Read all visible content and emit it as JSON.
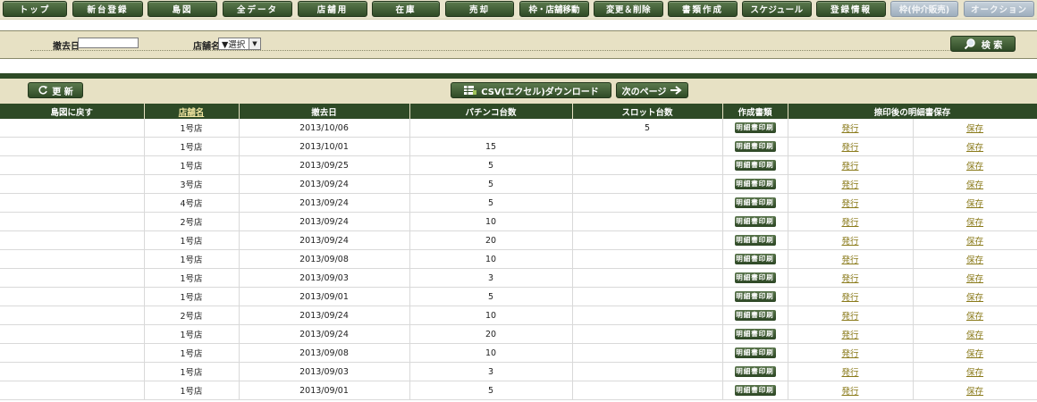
{
  "nav": [
    {
      "label": "トップ",
      "disabled": false
    },
    {
      "label": "新台登録",
      "disabled": false
    },
    {
      "label": "島図",
      "disabled": false
    },
    {
      "label": "全データ",
      "disabled": false
    },
    {
      "label": "店舗用",
      "disabled": false
    },
    {
      "label": "在庫",
      "disabled": false
    },
    {
      "label": "売却",
      "disabled": false
    },
    {
      "label": "枠・店舗移動",
      "disabled": false
    },
    {
      "label": "変更＆削除",
      "disabled": false
    },
    {
      "label": "書類作成",
      "disabled": false
    },
    {
      "label": "スケジュール",
      "disabled": false
    },
    {
      "label": "登録情報",
      "disabled": false
    },
    {
      "label": "枠(仲介販売)",
      "disabled": true
    },
    {
      "label": "オークション",
      "disabled": true
    }
  ],
  "search": {
    "date_label": "撤去日",
    "date_value": "",
    "store_label": "店舗名",
    "store_selected": "▼選択",
    "search_label": "検 索"
  },
  "toolbar": {
    "refresh_label": "更 新",
    "csv_label": "CSV(エクセル)ダウンロード",
    "next_label": "次のページ"
  },
  "table": {
    "headers": [
      "島図に戻す",
      "店舗名",
      "撤去日",
      "パチンコ台数",
      "スロット台数",
      "作成書類",
      "捺印後の明細書保存"
    ],
    "print_label": "明細書印刷",
    "issue_label": "発行",
    "save_label": "保存",
    "rows": [
      {
        "store": "1号店",
        "date": "2013/10/06",
        "pachinko": "",
        "slot": "5"
      },
      {
        "store": "1号店",
        "date": "2013/10/01",
        "pachinko": "15",
        "slot": ""
      },
      {
        "store": "1号店",
        "date": "2013/09/25",
        "pachinko": "5",
        "slot": ""
      },
      {
        "store": "3号店",
        "date": "2013/09/24",
        "pachinko": "5",
        "slot": ""
      },
      {
        "store": "4号店",
        "date": "2013/09/24",
        "pachinko": "5",
        "slot": ""
      },
      {
        "store": "2号店",
        "date": "2013/09/24",
        "pachinko": "10",
        "slot": ""
      },
      {
        "store": "1号店",
        "date": "2013/09/24",
        "pachinko": "20",
        "slot": ""
      },
      {
        "store": "1号店",
        "date": "2013/09/08",
        "pachinko": "10",
        "slot": ""
      },
      {
        "store": "1号店",
        "date": "2013/09/03",
        "pachinko": "3",
        "slot": ""
      },
      {
        "store": "1号店",
        "date": "2013/09/01",
        "pachinko": "5",
        "slot": ""
      },
      {
        "store": "2号店",
        "date": "2013/09/24",
        "pachinko": "10",
        "slot": ""
      },
      {
        "store": "1号店",
        "date": "2013/09/24",
        "pachinko": "20",
        "slot": ""
      },
      {
        "store": "1号店",
        "date": "2013/09/08",
        "pachinko": "10",
        "slot": ""
      },
      {
        "store": "1号店",
        "date": "2013/09/03",
        "pachinko": "3",
        "slot": ""
      },
      {
        "store": "1号店",
        "date": "2013/09/01",
        "pachinko": "5",
        "slot": ""
      }
    ]
  }
}
